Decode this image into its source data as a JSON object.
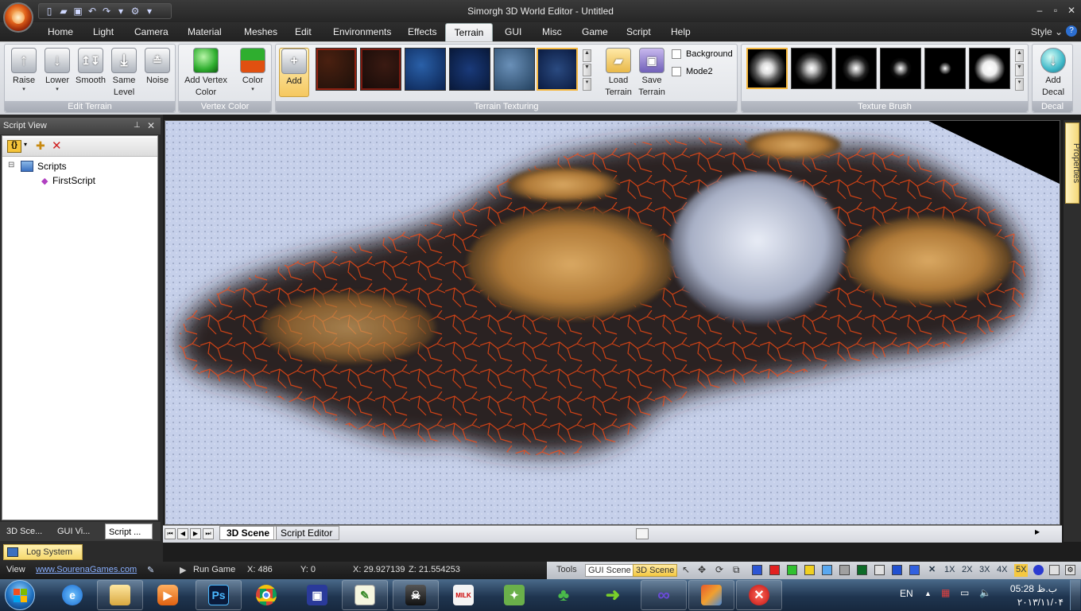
{
  "window": {
    "title": "Simorgh 3D World Editor - Untitled"
  },
  "menu": {
    "tabs": [
      "Home",
      "Light",
      "Camera",
      "Material",
      "Meshes",
      "Edit",
      "Environments",
      "Effects",
      "Terrain",
      "GUI",
      "Misc",
      "Game",
      "Script",
      "Help"
    ],
    "active": "Terrain",
    "style_label": "Style"
  },
  "ribbon": {
    "edit_terrain": {
      "label": "Edit Terrain",
      "buttons": [
        "Raise",
        "Lower",
        "Smooth",
        "Same Level",
        "Noise"
      ]
    },
    "vertex_color": {
      "label": "Vertex Color",
      "add_vertex_color": "Add Vertex Color",
      "color": "Color"
    },
    "terrain_texturing": {
      "label": "Terrain Texturing",
      "add": "Add",
      "load_terrain": "Load Terrain",
      "save_terrain": "Save Terrain",
      "background": "Background",
      "mode2": "Mode2"
    },
    "texture_brush": {
      "label": "Texture Brush"
    },
    "decal": {
      "label": "Decal",
      "add_decal": "Add Decal"
    }
  },
  "script_view": {
    "title": "Script View",
    "tree_root": "Scripts",
    "tree_child": "FirstScript",
    "bottom_tabs": [
      "3D Sce...",
      "GUI Vi...",
      "Script ..."
    ],
    "log_tab": "Log System"
  },
  "viewport": {
    "doc_tabs": [
      "3D Scene",
      "Script Editor"
    ],
    "properties_tab": "Properties"
  },
  "status": {
    "view": "View",
    "site": "www.SourenaGames.com",
    "run_game": "Run Game",
    "x": "X: 486",
    "y": "Y: 0",
    "world_x": "X: 29.927139",
    "world_z": "Z: 21.554253",
    "tools": "Tools",
    "gui_scene": "GUI Scene",
    "scene_3d": "3D Scene",
    "zoom": [
      "1X",
      "2X",
      "3X",
      "4X",
      "5X"
    ],
    "colors": [
      "#2b55d4",
      "#e22020",
      "#30c030",
      "#f0d020",
      "#59a8f0",
      "#a0a0a0",
      "#0d6b28",
      "#e0e0e0",
      "#2050d0",
      "#3060e0"
    ]
  },
  "taskbar": {
    "lang": "EN",
    "time": "05:28 ب.ظ",
    "date": "۲۰۱۳/۱۱/۰۴"
  }
}
